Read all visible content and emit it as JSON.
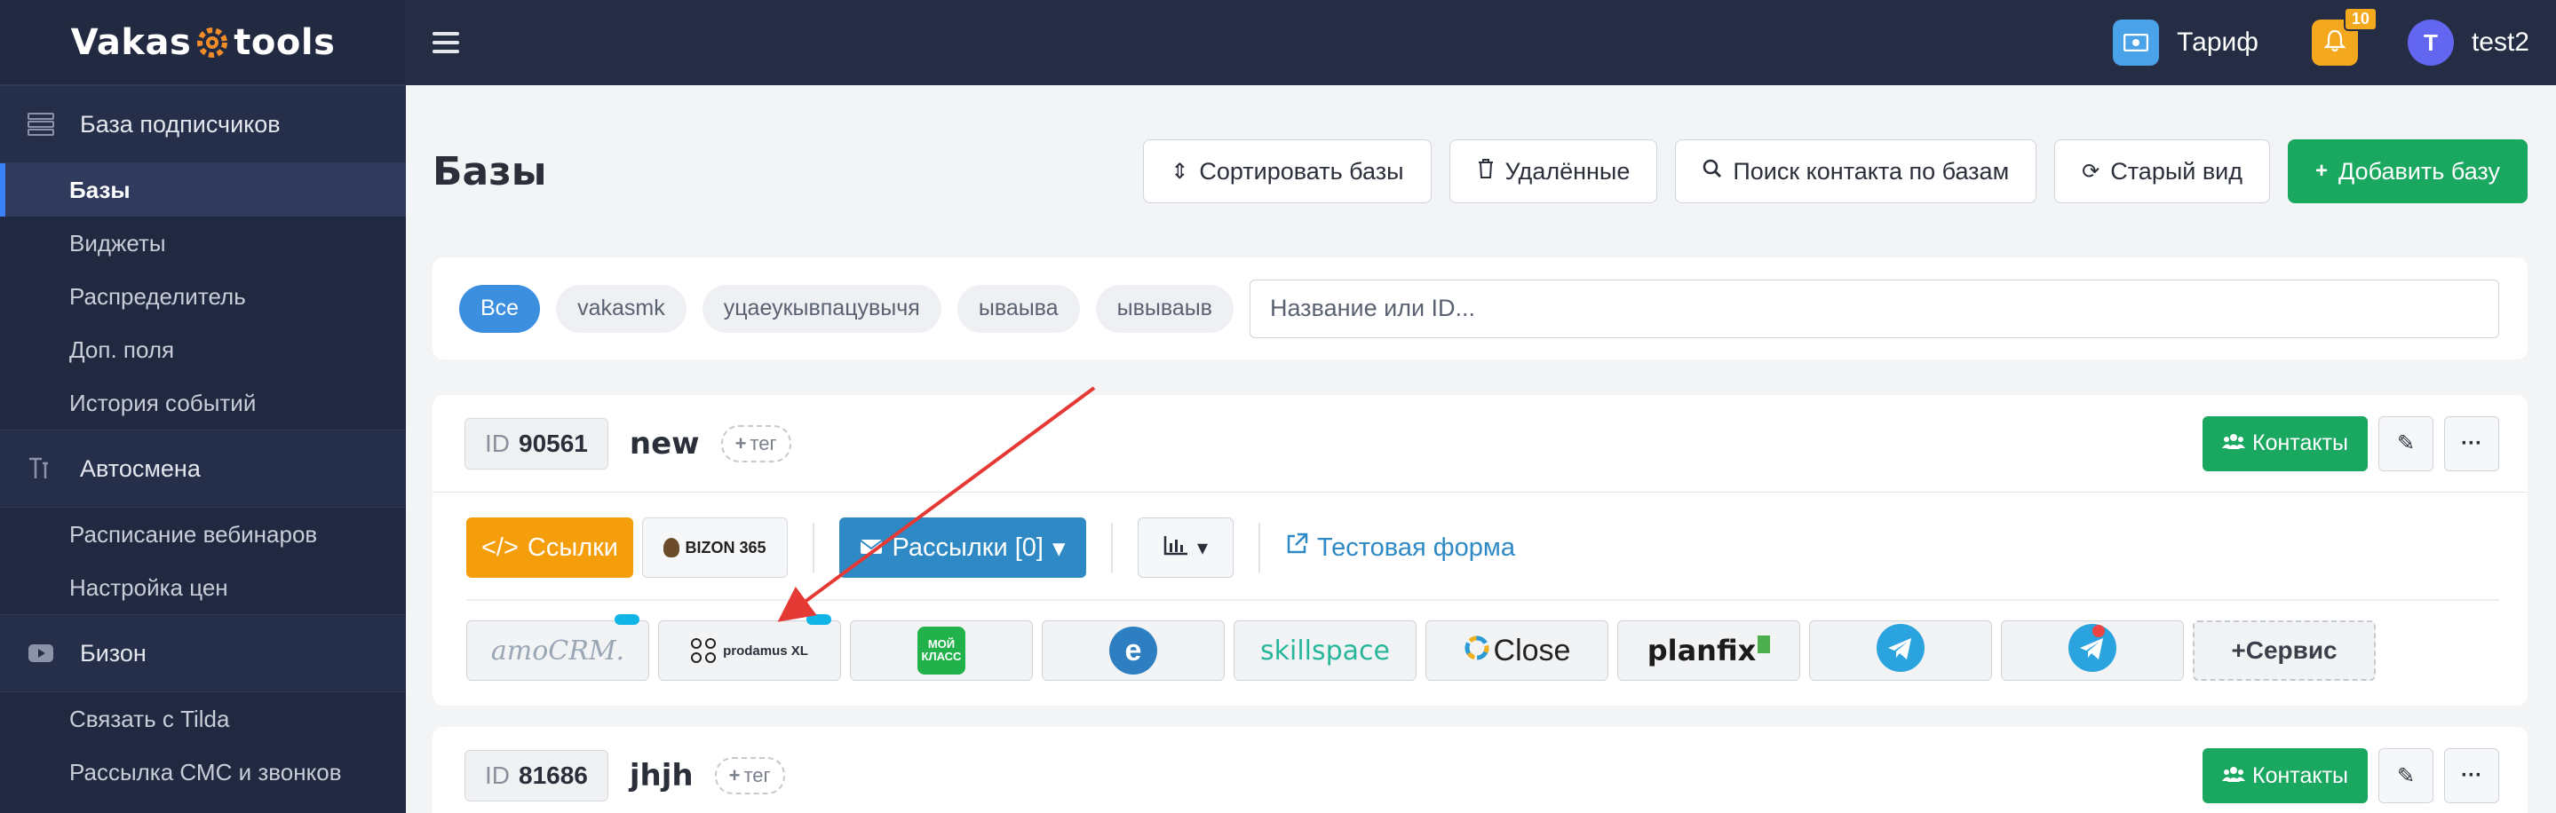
{
  "brand": {
    "left": "Vakas",
    "right": "tools"
  },
  "sidebar": {
    "sections": [
      {
        "title": "База подписчиков",
        "icon": "database-icon",
        "items": [
          {
            "label": "Базы",
            "active": true
          },
          {
            "label": "Виджеты"
          },
          {
            "label": "Распределитель"
          },
          {
            "label": "Доп. поля"
          },
          {
            "label": "История событий"
          }
        ]
      },
      {
        "title": "Автосмена",
        "icon": "text-height-icon",
        "items": [
          {
            "label": "Расписание вебинаров"
          },
          {
            "label": "Настройка цен"
          }
        ]
      },
      {
        "title": "Бизон",
        "icon": "youtube-icon",
        "items": [
          {
            "label": "Связать с Tilda"
          },
          {
            "label": "Рассылка СМС и звонков"
          }
        ]
      }
    ]
  },
  "topbar": {
    "tariff_label": "Тариф",
    "notifications_count": "10",
    "avatar_letter": "T",
    "username": "test2"
  },
  "page": {
    "title": "Базы",
    "toolbar": {
      "sort": "Сортировать базы",
      "deleted": "Удалённые",
      "search_contact": "Поиск контакта по базам",
      "old_view": "Старый вид",
      "add_base": "Добавить базу"
    }
  },
  "filters": {
    "chips": [
      "Все",
      "vakasmk",
      "уцаеукывпацувычя",
      "ываыва",
      "ывываыв"
    ],
    "search_placeholder": "Название или ID..."
  },
  "databases": [
    {
      "id_label": "ID",
      "id": "90561",
      "name": "new",
      "tag_label": "тег",
      "contacts_label": "Контакты",
      "links_label": "Ссылки",
      "bizon_label": "BIZON 365",
      "mailings_label": "Рассылки [0]",
      "test_form_label": "Тестовая форма",
      "services": {
        "amocrm": "amoCRM.",
        "prodamus": "prodamus XL",
        "moyklass_1": "МОЙ",
        "moyklass_2": "КЛАСС",
        "skillspace": "skillspace",
        "close": "Close",
        "planfix": "planfix",
        "add_service": "Сервис"
      }
    },
    {
      "id_label": "ID",
      "id": "81686",
      "name": "jhjh",
      "tag_label": "тег",
      "contacts_label": "Контакты"
    }
  ],
  "colors": {
    "sidebar_bg": "#212941",
    "accent_blue": "#3b8fde",
    "green": "#1aa760",
    "orange": "#f59e0b",
    "mail_blue": "#2e89c4",
    "annotation_arrow": "#e53935"
  }
}
